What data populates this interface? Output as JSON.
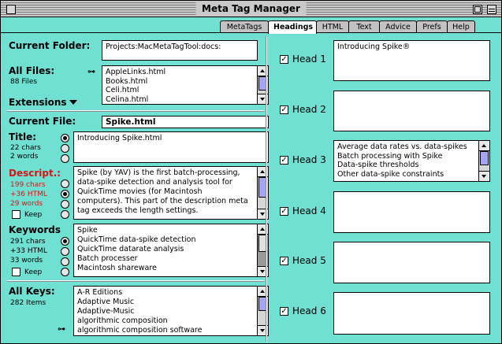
{
  "window": {
    "title": "Meta Tag Manager"
  },
  "tabs": [
    "MetaTags",
    "Headings",
    "HTML",
    "Text",
    "Advice",
    "Prefs",
    "Help"
  ],
  "active_tab": "Headings",
  "left": {
    "current_folder_label": "Current Folder:",
    "current_folder_value": "Projects:MacMetaTagTool:docs:",
    "all_files_label": "All Files:",
    "all_files_count": "88 Files",
    "files": [
      "AppleLinks.html",
      "Books.html",
      "Celi.html",
      "Celina.html"
    ],
    "extensions_label": "Extensions",
    "current_file_label": "Current File:",
    "current_file_value": "Spike.html",
    "title_label": "Title:",
    "title_chars": "22 chars",
    "title_words": "2 words",
    "title_value": "Introducing Spike.html",
    "descript_label": "Descript.:",
    "descript_chars": "199 chars",
    "descript_html": "+36 HTML",
    "descript_words": "29 words",
    "descript_keep": "Keep",
    "descript_value": "Spike (by YAV) is the first batch-processing,\ndata-spike detection and analysis tool for\nQuickTime movies (for Macintosh\ncomputers). This part of the description meta\ntag exceeds the length settings.",
    "keywords_label": "Keywords",
    "keywords_chars": "291 chars",
    "keywords_html": "+33 HTML",
    "keywords_words": "33 words",
    "keywords_keep": "Keep",
    "keywords_value": "Spike\nQuickTime data-spike detection\nQuickTime datarate analysis\nBatch processer\nMacintosh shareware",
    "all_keys_label": "All Keys:",
    "all_keys_count": "282 Items",
    "all_keys_value": "A-R Editions\nAdaptive Music\nAdaptive-Music\nalgorithmic composition\nalgorithmic composition software"
  },
  "heads": [
    {
      "label": "Head 1",
      "value": "Introducing Spike®"
    },
    {
      "label": "Head 2",
      "value": ""
    },
    {
      "label": "Head 3",
      "value": "Average data rates vs. data-spikes\nBatch processing with Spike\nData-spike thresholds\nOther data-spike constraints"
    },
    {
      "label": "Head 4",
      "value": ""
    },
    {
      "label": "Head 5",
      "value": ""
    },
    {
      "label": "Head 6",
      "value": ""
    }
  ],
  "colors": {
    "background": "#6fe0d2",
    "warning": "#d01818",
    "scroll_thumb": "#a5a5f0"
  },
  "icons": [
    "close-box-icon",
    "zoom-box-icon",
    "collapse-box-icon",
    "key-icon",
    "triangle-down-icon",
    "checkmark-icon"
  ]
}
